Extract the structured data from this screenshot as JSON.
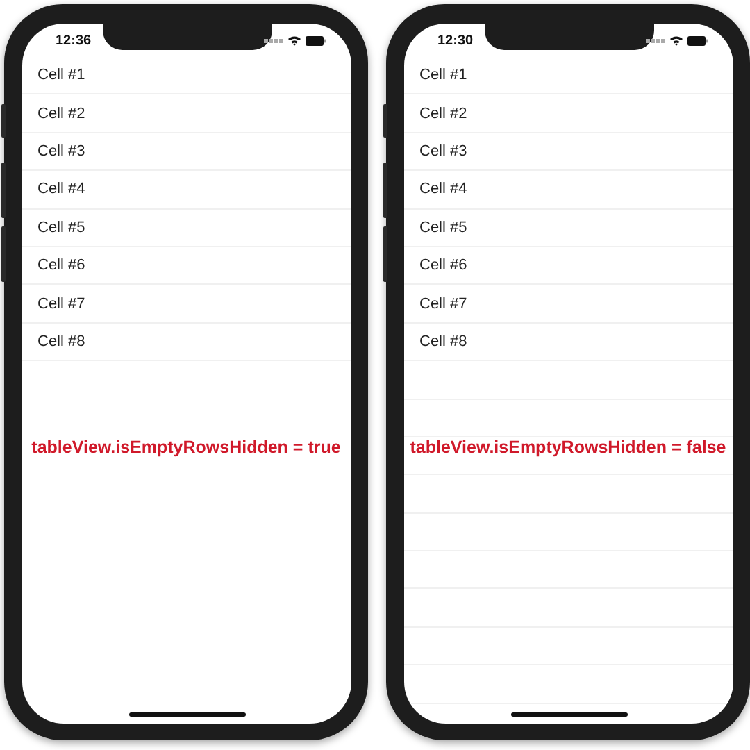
{
  "phones": [
    {
      "time": "12:36",
      "empty_rows_hidden": true,
      "cells": [
        "Cell #1",
        "Cell #2",
        "Cell #3",
        "Cell #4",
        "Cell #5",
        "Cell #6",
        "Cell #7",
        "Cell #8"
      ],
      "caption": "tableView.isEmptyRowsHidden = true"
    },
    {
      "time": "12:30",
      "empty_rows_hidden": false,
      "cells": [
        "Cell #1",
        "Cell #2",
        "Cell #3",
        "Cell #4",
        "Cell #5",
        "Cell #6",
        "Cell #7",
        "Cell #8"
      ],
      "caption": "tableView.isEmptyRowsHidden = false"
    }
  ]
}
